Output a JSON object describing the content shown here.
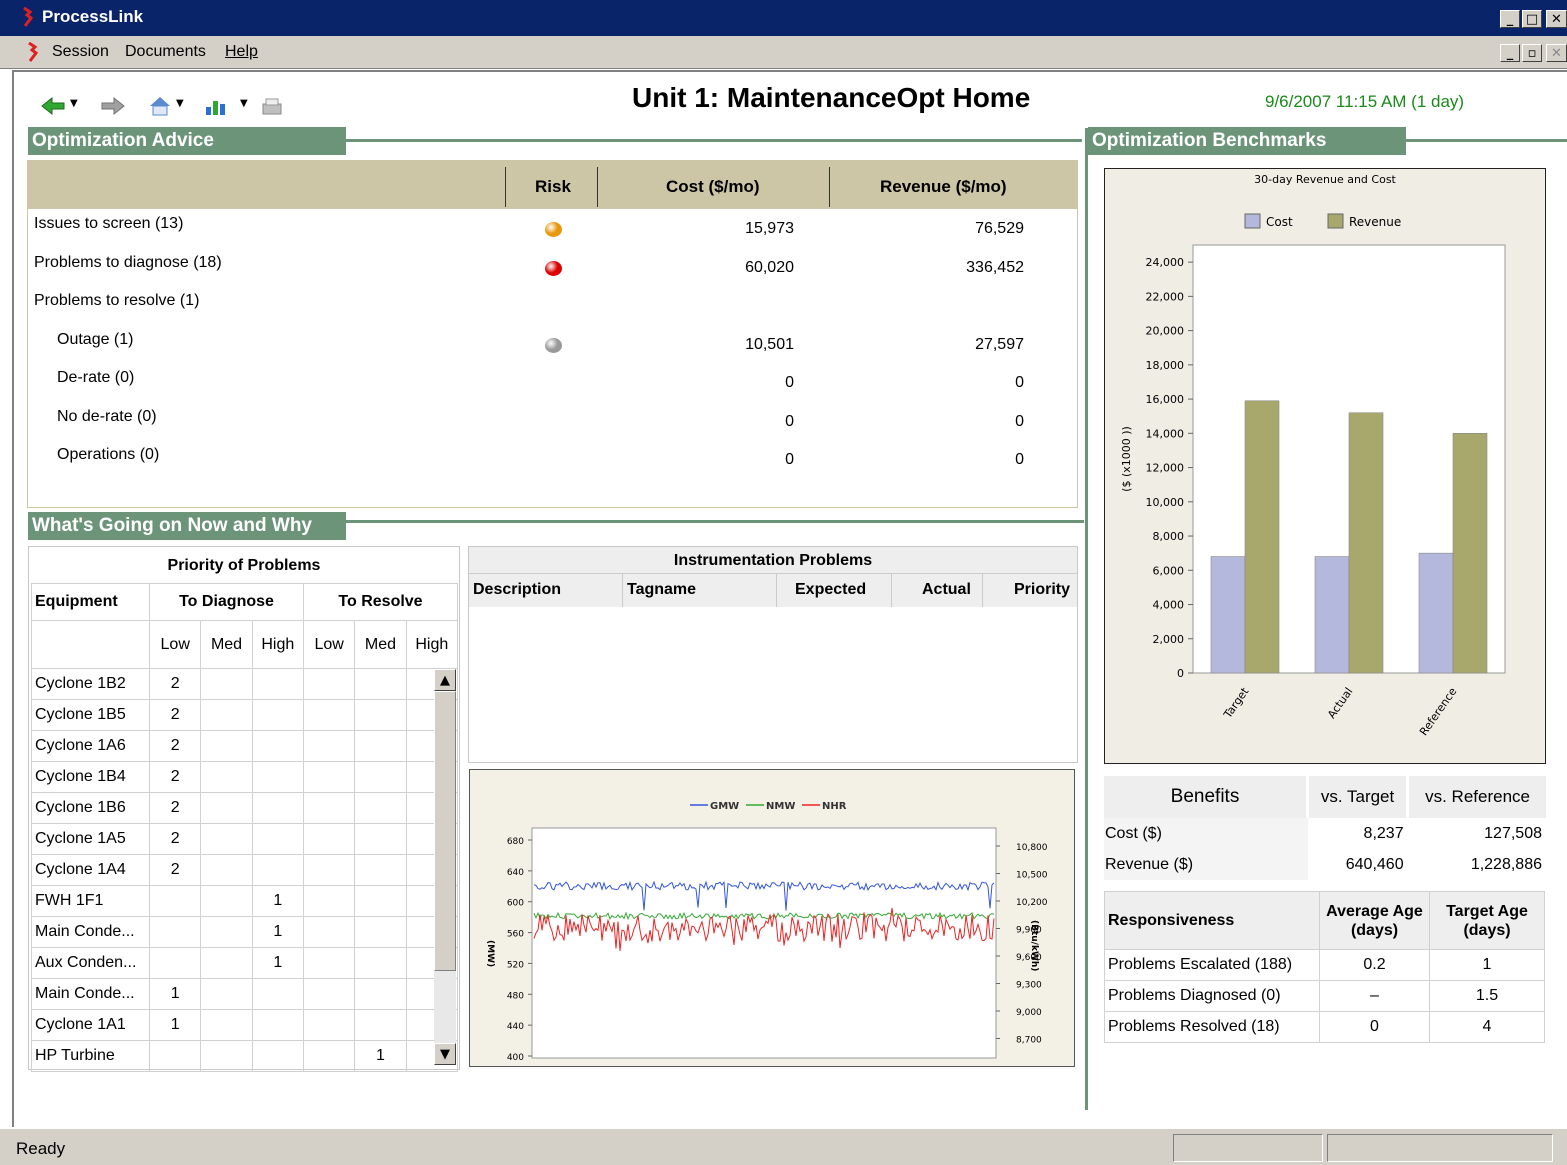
{
  "window": {
    "title": "ProcessLink"
  },
  "menu": {
    "items": [
      "Session",
      "Documents",
      "Help"
    ]
  },
  "page": {
    "title": "Unit 1: MaintenanceOpt Home",
    "timestamp": "9/6/2007 11:15 AM (1 day)"
  },
  "toolbar": {
    "icons": [
      "back-arrow-icon",
      "forward-arrow-icon",
      "home-icon",
      "chart-icon",
      "print-icon"
    ]
  },
  "advice": {
    "section_title": "Optimization Advice",
    "headers": {
      "risk": "Risk",
      "cost": "Cost ($/mo)",
      "revenue": "Revenue ($/mo)"
    },
    "rows": [
      {
        "label": "Issues to screen (13)",
        "risk": "#e8960c",
        "cost": "15,973",
        "revenue": "76,529",
        "indent": false
      },
      {
        "label": "Problems to diagnose (18)",
        "risk": "#dd0000",
        "cost": "60,020",
        "revenue": "336,452",
        "indent": false
      },
      {
        "label": "Problems to resolve (1)",
        "risk": "",
        "cost": "",
        "revenue": "",
        "indent": false
      },
      {
        "label": "Outage (1)",
        "risk": "#999999",
        "cost": "10,501",
        "revenue": "27,597",
        "indent": true
      },
      {
        "label": "De-rate (0)",
        "risk": "",
        "cost": "0",
        "revenue": "0",
        "indent": true
      },
      {
        "label": "No de-rate (0)",
        "risk": "",
        "cost": "0",
        "revenue": "0",
        "indent": true
      },
      {
        "label": "Operations (0)",
        "risk": "",
        "cost": "0",
        "revenue": "0",
        "indent": true
      }
    ]
  },
  "whatsgoing": {
    "section_title": "What's Going on Now and Why"
  },
  "priority": {
    "title": "Priority of Problems",
    "col_equipment": "Equipment",
    "col_diagnose": "To Diagnose",
    "col_resolve": "To Resolve",
    "levels": [
      "Low",
      "Med",
      "High",
      "Low",
      "Med",
      "High"
    ],
    "rows": [
      {
        "name": "Cyclone 1B2",
        "v": [
          "2",
          "",
          "",
          "",
          "",
          ""
        ]
      },
      {
        "name": "Cyclone 1B5",
        "v": [
          "2",
          "",
          "",
          "",
          "",
          ""
        ]
      },
      {
        "name": "Cyclone 1A6",
        "v": [
          "2",
          "",
          "",
          "",
          "",
          ""
        ]
      },
      {
        "name": "Cyclone 1B4",
        "v": [
          "2",
          "",
          "",
          "",
          "",
          ""
        ]
      },
      {
        "name": "Cyclone 1B6",
        "v": [
          "2",
          "",
          "",
          "",
          "",
          ""
        ]
      },
      {
        "name": "Cyclone 1A5",
        "v": [
          "2",
          "",
          "",
          "",
          "",
          ""
        ]
      },
      {
        "name": "Cyclone 1A4",
        "v": [
          "2",
          "",
          "",
          "",
          "",
          ""
        ]
      },
      {
        "name": "FWH 1F1",
        "v": [
          "",
          "",
          "1",
          "",
          "",
          ""
        ]
      },
      {
        "name": "Main Conde...",
        "v": [
          "",
          "",
          "1",
          "",
          "",
          ""
        ]
      },
      {
        "name": "Aux Conden...",
        "v": [
          "",
          "",
          "1",
          "",
          "",
          ""
        ]
      },
      {
        "name": "Main Conde...",
        "v": [
          "1",
          "",
          "",
          "",
          "",
          ""
        ]
      },
      {
        "name": "Cyclone 1A1",
        "v": [
          "1",
          "",
          "",
          "",
          "",
          ""
        ]
      },
      {
        "name": "HP Turbine",
        "v": [
          "",
          "",
          "",
          "",
          "1",
          ""
        ]
      }
    ]
  },
  "instrumentation": {
    "title": "Instrumentation Problems",
    "columns": [
      "Description",
      "Tagname",
      "Expected",
      "Actual",
      "Priority"
    ]
  },
  "trend": {
    "legend": [
      "GMW",
      "NMW",
      "NHR"
    ],
    "colors": [
      "#3355dd",
      "#33aa33",
      "#ee2222"
    ],
    "left_axis_label": "(MW)",
    "right_axis_label": "(Btu/kWh)",
    "left_ticks": [
      "680",
      "640",
      "600",
      "560",
      "520",
      "480",
      "440",
      "400"
    ],
    "right_ticks": [
      "10,800",
      "10,500",
      "10,200",
      "9,900",
      "9,600",
      "9,300",
      "9,000",
      "8,700"
    ]
  },
  "benchmarks": {
    "section_title": "Optimization Benchmarks"
  },
  "chart_data": {
    "type": "bar",
    "title": "30-day Revenue and Cost",
    "categories": [
      "Target",
      "Actual",
      "Reference"
    ],
    "series": [
      {
        "name": "Cost",
        "color": "#b4b8dc",
        "values": [
          6800,
          6800,
          7000
        ]
      },
      {
        "name": "Revenue",
        "color": "#a8a86c",
        "values": [
          15900,
          15200,
          14000
        ]
      }
    ],
    "ylabel": "($ (x1000 ))",
    "ylim": [
      0,
      25000
    ],
    "yticks": [
      "0",
      "2,000",
      "4,000",
      "6,000",
      "8,000",
      "10,000",
      "12,000",
      "14,000",
      "16,000",
      "18,000",
      "20,000",
      "22,000",
      "24,000"
    ],
    "legend_position": "top"
  },
  "benefits": {
    "headers": [
      "Benefits",
      "vs. Target",
      "vs. Reference"
    ],
    "rows": [
      {
        "label": "Cost ($)",
        "target": "8,237",
        "reference": "127,508"
      },
      {
        "label": "Revenue ($)",
        "target": "640,460",
        "reference": "1,228,886"
      }
    ]
  },
  "responsiveness": {
    "headers": [
      "Responsiveness",
      "Average Age (days)",
      "Target Age (days)"
    ],
    "rows": [
      {
        "label": "Problems Escalated (188)",
        "avg": "0.2",
        "target": "1"
      },
      {
        "label": "Problems Diagnosed (0)",
        "avg": "–",
        "target": "1.5"
      },
      {
        "label": "Problems Resolved (18)",
        "avg": "0",
        "target": "4"
      }
    ]
  },
  "status": {
    "text": "Ready"
  }
}
